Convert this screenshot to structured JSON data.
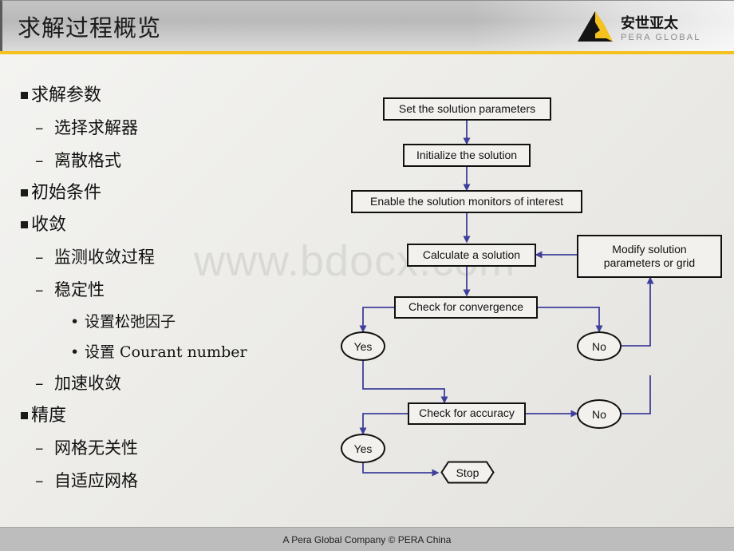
{
  "slide": {
    "title": "求解过程概览",
    "watermark": "www.bdocx.com",
    "accent_yellow": "#f5c11e",
    "arrow_color": "#3f3f9b",
    "shape_border_color": "#111111"
  },
  "logo": {
    "name": "pera-global-logo",
    "chinese_name": "安世亚太",
    "english_name": "PERA GLOBAL",
    "mark_black": "#141414",
    "mark_yellow": "#f5c11e"
  },
  "bullets": [
    {
      "level": 1,
      "marker": "square",
      "text": "求解参数"
    },
    {
      "level": 2,
      "marker": "dash",
      "text": "选择求解器"
    },
    {
      "level": 2,
      "marker": "dash",
      "text": "离散格式"
    },
    {
      "level": 1,
      "marker": "square",
      "text": "初始条件"
    },
    {
      "level": 1,
      "marker": "square",
      "text": "收敛"
    },
    {
      "level": 2,
      "marker": "dash",
      "text": "监测收敛过程"
    },
    {
      "level": 2,
      "marker": "dash",
      "text": "稳定性"
    },
    {
      "level": 3,
      "marker": "dot",
      "text": "设置松弛因子"
    },
    {
      "level": 3,
      "marker": "dot",
      "text": "设置 Courant number"
    },
    {
      "level": 2,
      "marker": "dash",
      "text": "加速收敛"
    },
    {
      "level": 1,
      "marker": "square",
      "text": "精度"
    },
    {
      "level": 2,
      "marker": "dash",
      "text": "网格无关性"
    },
    {
      "level": 2,
      "marker": "dash",
      "text": "自适应网格"
    }
  ],
  "flowchart": {
    "nodes": [
      {
        "id": "set_params",
        "shape": "rect",
        "label": "Set the solution parameters"
      },
      {
        "id": "initialize",
        "shape": "rect",
        "label": "Initialize the solution"
      },
      {
        "id": "enable_mon",
        "shape": "rect",
        "label": "Enable the solution monitors of interest"
      },
      {
        "id": "calculate",
        "shape": "rect",
        "label": "Calculate a solution"
      },
      {
        "id": "modify",
        "shape": "rect",
        "label": "Modify solution parameters or grid"
      },
      {
        "id": "check_conv",
        "shape": "rect",
        "label": "Check for convergence"
      },
      {
        "id": "conv_yes",
        "shape": "ellipse",
        "label": "Yes"
      },
      {
        "id": "conv_no",
        "shape": "ellipse",
        "label": "No"
      },
      {
        "id": "check_acc",
        "shape": "rect",
        "label": "Check for accuracy"
      },
      {
        "id": "acc_yes",
        "shape": "ellipse",
        "label": "Yes"
      },
      {
        "id": "acc_no",
        "shape": "ellipse",
        "label": "No"
      },
      {
        "id": "stop",
        "shape": "hexagon",
        "label": "Stop"
      }
    ],
    "modify_line_1": "Modify solution",
    "modify_line_2": "parameters or grid"
  },
  "footer": {
    "text": "A Pera Global Company ©  PERA China"
  }
}
